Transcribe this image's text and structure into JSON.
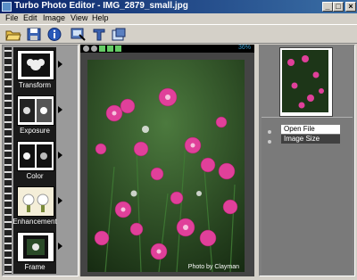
{
  "window": {
    "title": "Turbo Photo Editor - IMG_2879_small.jpg",
    "min_label": "_",
    "max_label": "□",
    "close_label": "×"
  },
  "menu": {
    "items": [
      "File",
      "Edit",
      "Image",
      "View",
      "Help"
    ]
  },
  "toolbar": {
    "buttons": [
      "open-icon",
      "save-icon",
      "info-icon",
      "screen-icon",
      "text-icon",
      "resize-icon"
    ]
  },
  "tools": [
    {
      "label": "Transform",
      "icon": "transform-icon"
    },
    {
      "label": "Exposure",
      "icon": "exposure-icon"
    },
    {
      "label": "Color",
      "icon": "color-icon"
    },
    {
      "label": "Enhancement",
      "icon": "enhancement-icon"
    },
    {
      "label": "Frame",
      "icon": "frame-icon"
    }
  ],
  "zoom": {
    "percent": "36%"
  },
  "photo": {
    "credit": "Photo by Clayman"
  },
  "history": {
    "items": [
      "Open File",
      "Image Size"
    ]
  },
  "colors": {
    "title_start": "#0a246a",
    "title_end": "#3a6ea5",
    "flower": "#e0409a",
    "foliage": "#2e5a28"
  }
}
